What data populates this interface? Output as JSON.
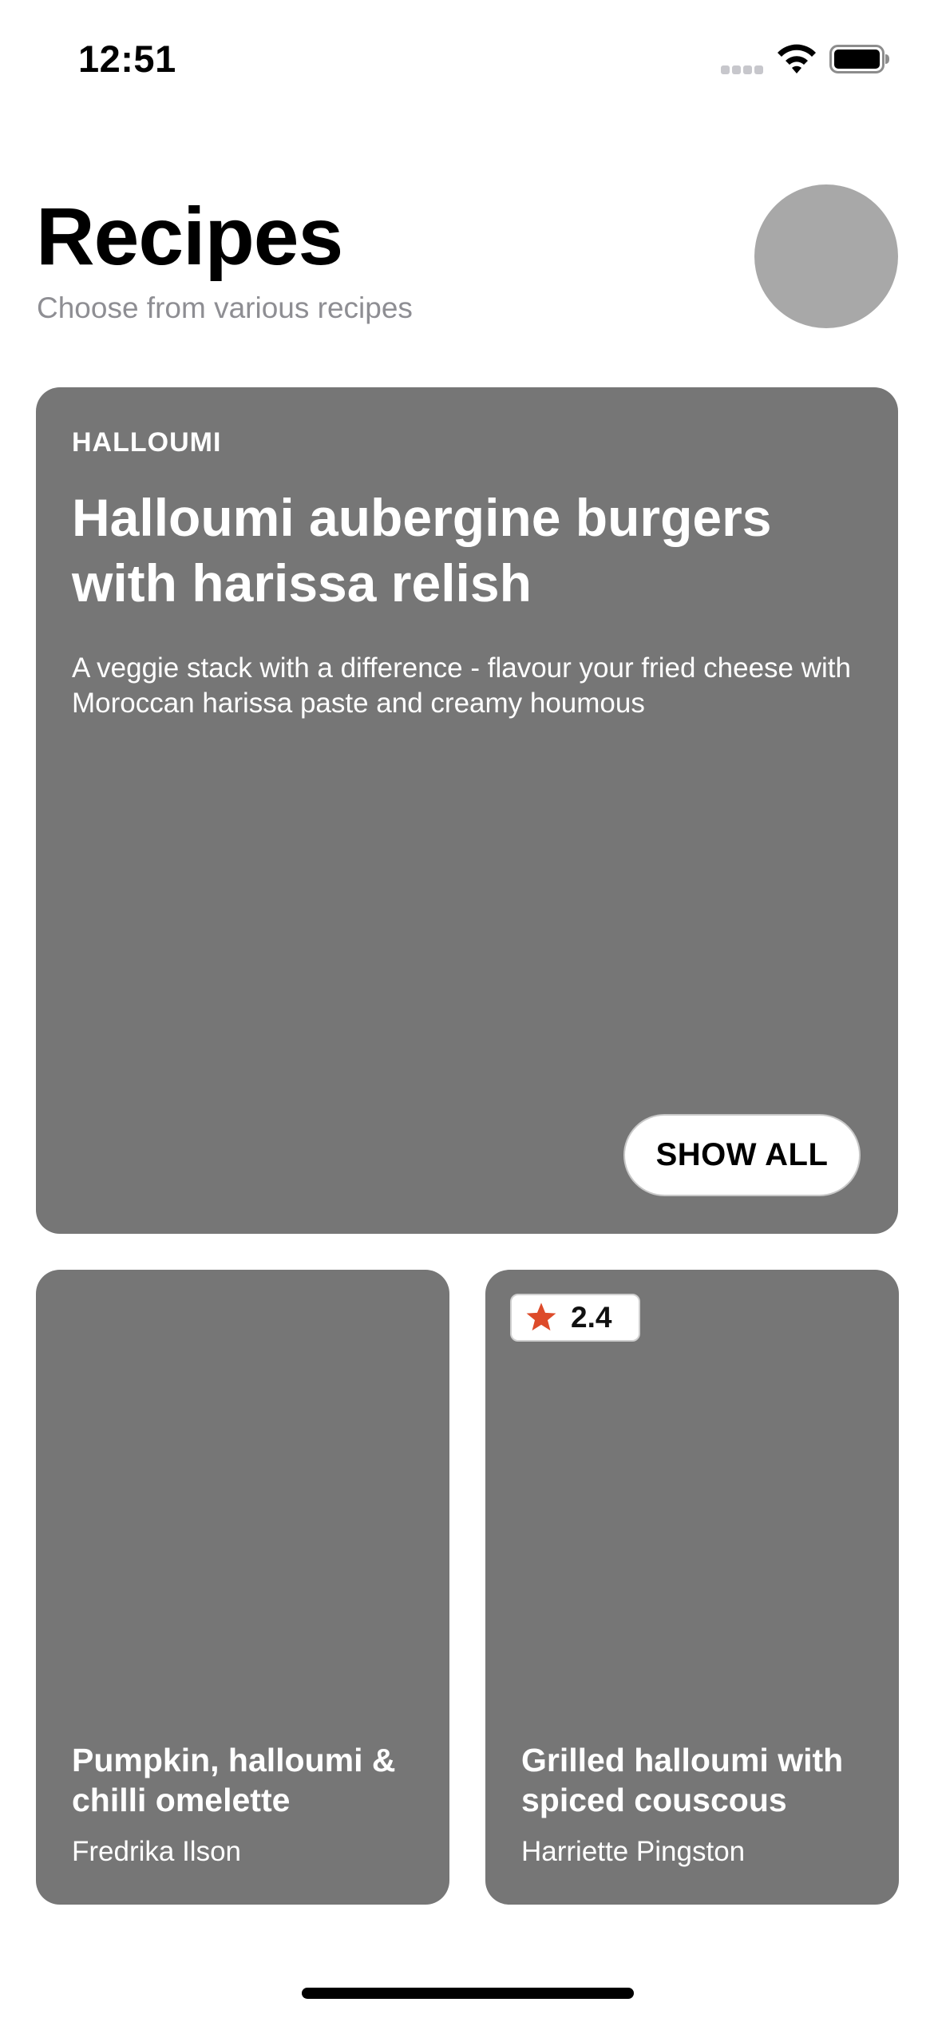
{
  "status_bar": {
    "time": "12:51",
    "icons": [
      "signal-dots-icon",
      "wifi-icon",
      "battery-icon"
    ]
  },
  "header": {
    "title": "Recipes",
    "subtitle": "Choose from various recipes"
  },
  "featured": {
    "category": "HALLOUMI",
    "title": "Halloumi aubergine burgers with harissa relish",
    "description": "A veggie stack with a difference - flavour your fried cheese with Moroccan harissa paste and creamy houmous",
    "button_label": "SHOW ALL"
  },
  "recipes": [
    {
      "title": "Pumpkin, halloumi & chilli omelette",
      "author": "Fredrika Ilson"
    },
    {
      "title": "Grilled halloumi with spiced couscous",
      "author": "Harriette Pingston",
      "rating": "2.4"
    }
  ],
  "colors": {
    "card_background": "#767676",
    "avatar_placeholder": "#a8a8a8",
    "subtitle_gray": "#8e8e93",
    "star": "#dd4b2a"
  }
}
